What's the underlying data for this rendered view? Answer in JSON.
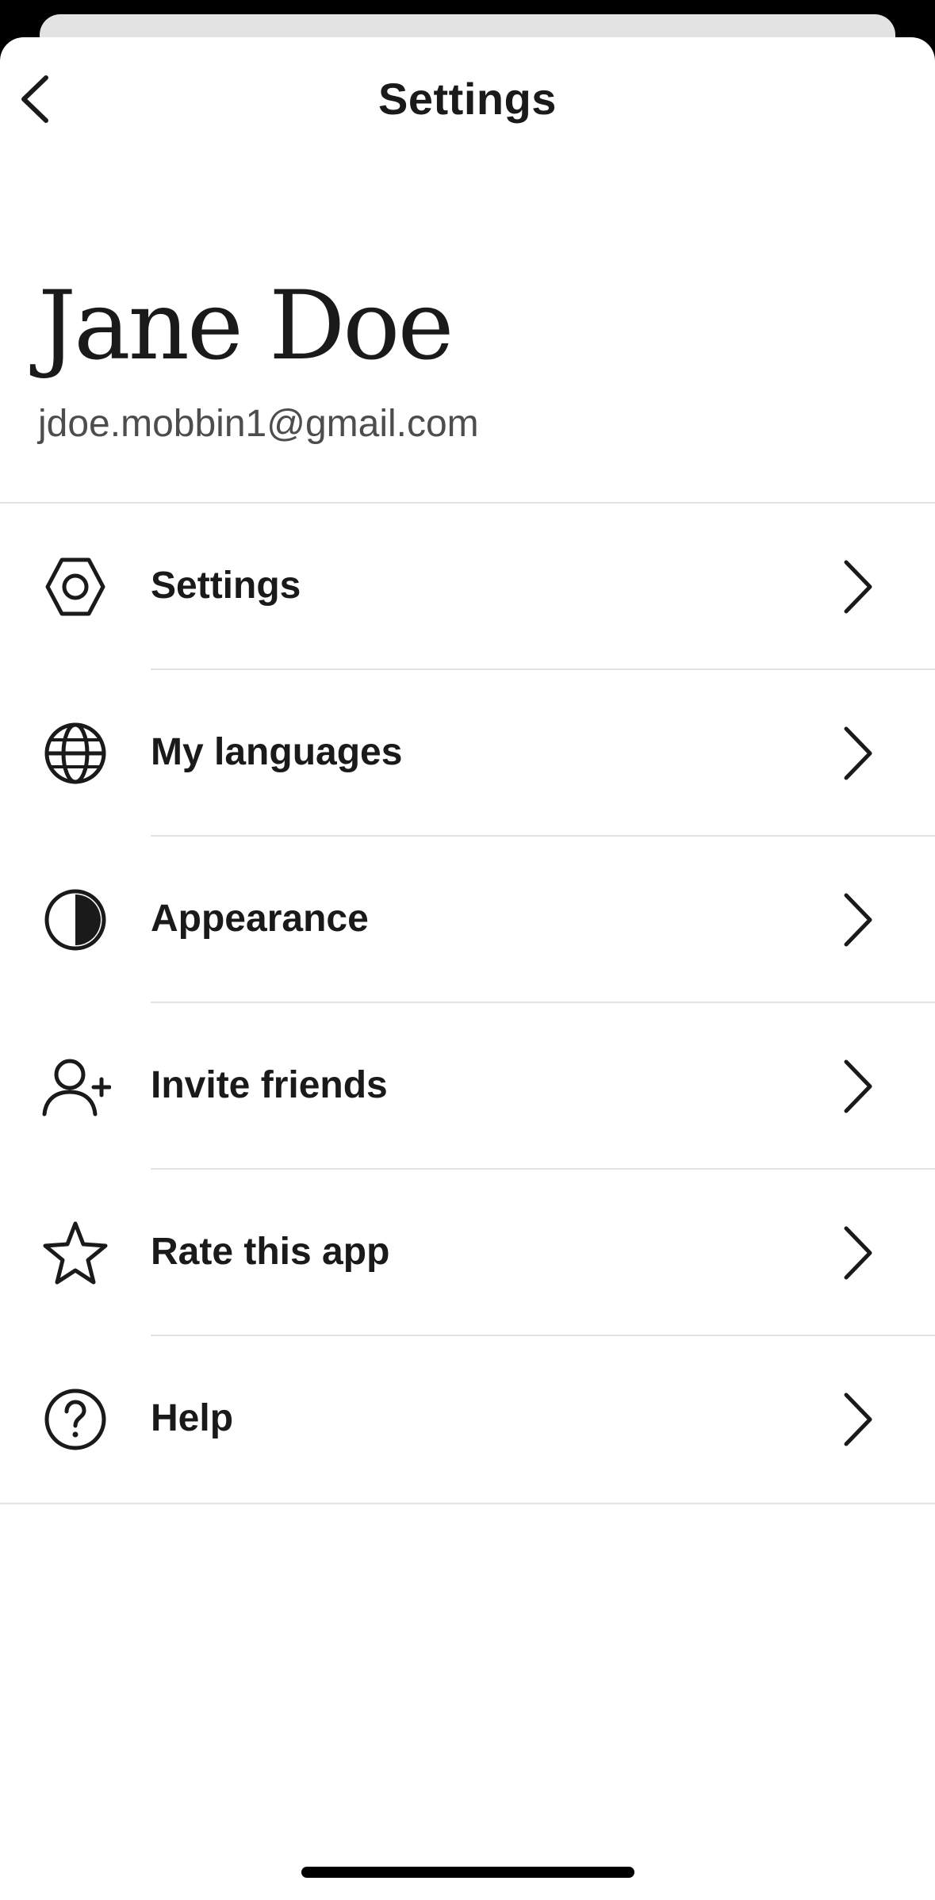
{
  "header": {
    "title": "Settings"
  },
  "profile": {
    "name": "Jane Doe",
    "email": "jdoe.mobbin1@gmail.com"
  },
  "menu": {
    "items": [
      {
        "label": "Settings",
        "icon": "gear-icon"
      },
      {
        "label": "My languages",
        "icon": "globe-icon"
      },
      {
        "label": "Appearance",
        "icon": "half-circle-contrast-icon"
      },
      {
        "label": "Invite friends",
        "icon": "add-person-icon"
      },
      {
        "label": "Rate this app",
        "icon": "star-icon"
      },
      {
        "label": "Help",
        "icon": "question-circle-icon"
      }
    ]
  },
  "colors": {
    "text": "#1a1a1a",
    "secondary_text": "#4d4d4d",
    "divider": "#e3e3e3",
    "background": "#ffffff"
  }
}
